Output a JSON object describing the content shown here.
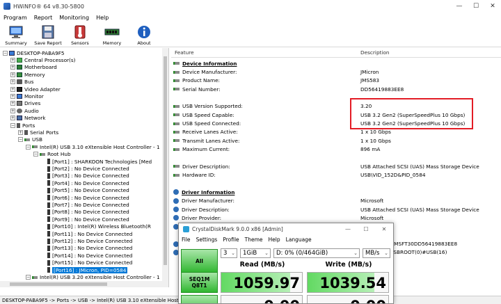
{
  "window": {
    "title": "HWiNFO® 64 v8.30-5800"
  },
  "menu": [
    "Program",
    "Report",
    "Monitoring",
    "Help"
  ],
  "toolbar": [
    {
      "label": "Summary",
      "icon": "summary-icon"
    },
    {
      "label": "Save Report",
      "icon": "save-icon"
    },
    {
      "label": "Sensors",
      "icon": "sensors-icon"
    },
    {
      "label": "Memory",
      "icon": "memory-icon"
    },
    {
      "label": "About",
      "icon": "about-icon"
    }
  ],
  "tree": [
    {
      "label": "DESKTOP-PABA9F5",
      "level": 0,
      "exp": "-",
      "icon": "computer-icon"
    },
    {
      "label": "Central Processor(s)",
      "level": 1,
      "exp": "+",
      "icon": "cpu-icon"
    },
    {
      "label": "Motherboard",
      "level": 1,
      "exp": "+",
      "icon": "motherboard-icon"
    },
    {
      "label": "Memory",
      "level": 1,
      "exp": "+",
      "icon": "memory-icon"
    },
    {
      "label": "Bus",
      "level": 1,
      "exp": "+",
      "icon": "bus-icon"
    },
    {
      "label": "Video Adapter",
      "level": 1,
      "exp": "+",
      "icon": "video-icon"
    },
    {
      "label": "Monitor",
      "level": 1,
      "exp": "+",
      "icon": "monitor-icon"
    },
    {
      "label": "Drives",
      "level": 1,
      "exp": "+",
      "icon": "drive-icon"
    },
    {
      "label": "Audio",
      "level": 1,
      "exp": "+",
      "icon": "audio-icon"
    },
    {
      "label": "Network",
      "level": 1,
      "exp": "+",
      "icon": "network-icon"
    },
    {
      "label": "Ports",
      "level": 1,
      "exp": "-",
      "icon": "port-icon"
    },
    {
      "label": "Serial Ports",
      "level": 2,
      "exp": "+",
      "icon": "port-icon"
    },
    {
      "label": "USB",
      "level": 2,
      "exp": "-",
      "icon": "usb-icon"
    },
    {
      "label": "Intel(R) USB 3.10 eXtensible Host Controller - 1",
      "level": 3,
      "exp": "-",
      "icon": "usb-icon"
    },
    {
      "label": "Root Hub",
      "level": 4,
      "exp": "-",
      "icon": "usb-icon"
    },
    {
      "label": "[Port1] : SHARKOON Technologies [Med",
      "level": 5,
      "exp": "",
      "icon": "plug-icon"
    },
    {
      "label": "[Port2] : No Device Connected",
      "level": 5,
      "exp": "",
      "icon": "plug-icon"
    },
    {
      "label": "[Port3] : No Device Connected",
      "level": 5,
      "exp": "",
      "icon": "plug-icon"
    },
    {
      "label": "[Port4] : No Device Connected",
      "level": 5,
      "exp": "",
      "icon": "plug-icon"
    },
    {
      "label": "[Port5] : No Device Connected",
      "level": 5,
      "exp": "",
      "icon": "plug-icon"
    },
    {
      "label": "[Port6] : No Device Connected",
      "level": 5,
      "exp": "",
      "icon": "plug-icon"
    },
    {
      "label": "[Port7] : No Device Connected",
      "level": 5,
      "exp": "",
      "icon": "plug-icon"
    },
    {
      "label": "[Port8] : No Device Connected",
      "level": 5,
      "exp": "",
      "icon": "plug-icon"
    },
    {
      "label": "[Port9] : No Device Connected",
      "level": 5,
      "exp": "",
      "icon": "plug-icon"
    },
    {
      "label": "[Port10] : Intel(R) Wireless Bluetooth(R",
      "level": 5,
      "exp": "",
      "icon": "plug-icon"
    },
    {
      "label": "[Port11] : No Device Connected",
      "level": 5,
      "exp": "",
      "icon": "plug-icon"
    },
    {
      "label": "[Port12] : No Device Connected",
      "level": 5,
      "exp": "",
      "icon": "plug-icon"
    },
    {
      "label": "[Port13] : No Device Connected",
      "level": 5,
      "exp": "",
      "icon": "plug-icon"
    },
    {
      "label": "[Port14] : No Device Connected",
      "level": 5,
      "exp": "",
      "icon": "plug-icon"
    },
    {
      "label": "[Port15] : No Device Connected",
      "level": 5,
      "exp": "",
      "icon": "plug-icon"
    },
    {
      "label": "[Port16] : JMicron, PID=0584",
      "level": 5,
      "exp": "",
      "icon": "plug-icon",
      "selected": true
    },
    {
      "label": "Intel(R) USB 3.20 eXtensible Host Controller - 1",
      "level": 3,
      "exp": "-",
      "icon": "usb-icon"
    },
    {
      "label": "Root Hub",
      "level": 4,
      "exp": "-",
      "icon": "usb-icon"
    }
  ],
  "details": {
    "col_feature": "Feature",
    "col_description": "Description",
    "rows": [
      {
        "feature": "Device Information",
        "value": "",
        "kind": "section",
        "icon": "usb-icon"
      },
      {
        "feature": "Device Manufacturer:",
        "value": "JMicron",
        "icon": "usb-icon"
      },
      {
        "feature": "Product Name:",
        "value": "JMS583",
        "icon": "usb-icon"
      },
      {
        "feature": "Serial Number:",
        "value": "DD56419883EE8",
        "icon": "usb-icon"
      },
      {
        "feature": "",
        "value": "",
        "kind": "blank"
      },
      {
        "feature": "USB Version Supported:",
        "value": "3.20",
        "icon": "usb-icon"
      },
      {
        "feature": "USB Speed Capable:",
        "value": "USB 3.2 Gen2 (SuperSpeedPlus 10 Gbps)",
        "icon": "usb-icon"
      },
      {
        "feature": "USB Speed Connected:",
        "value": "USB 3.2 Gen2 (SuperSpeedPlus 10 Gbps)",
        "icon": "usb-icon"
      },
      {
        "feature": "Receive Lanes Active:",
        "value": "1 x 10 Gbps",
        "icon": "usb-icon"
      },
      {
        "feature": "Transmit Lanes Active:",
        "value": "1 x 10 Gbps",
        "icon": "usb-icon"
      },
      {
        "feature": "Maximum Current:",
        "value": "896 mA",
        "icon": "usb-icon"
      },
      {
        "feature": "",
        "value": "",
        "kind": "blank"
      },
      {
        "feature": "Driver Description:",
        "value": "USB Attached SCSI (UAS) Mass Storage Device",
        "icon": "usb-icon"
      },
      {
        "feature": "Hardware ID:",
        "value": "USB\\VID_152D&PID_0584",
        "icon": "usb-icon"
      },
      {
        "feature": "",
        "value": "",
        "kind": "blank"
      },
      {
        "feature": "Driver Information",
        "value": "",
        "kind": "section",
        "icon": "gear-icon"
      },
      {
        "feature": "Driver Manufacturer:",
        "value": "Microsoft",
        "icon": "gear-icon"
      },
      {
        "feature": "Driver Description:",
        "value": "USB Attached SCSI (UAS) Mass Storage Device",
        "icon": "gear-icon"
      },
      {
        "feature": "Driver Provider:",
        "value": "Microsoft",
        "icon": "gear-icon"
      },
      {
        "feature": "",
        "value": "882",
        "icon": "gear-icon"
      },
      {
        "feature": "",
        "value": "",
        "kind": "blank"
      },
      {
        "feature": "",
        "value": "D&PID_0584\\MSFT30DD56419883EE8",
        "icon": "gear-icon"
      },
      {
        "feature": "",
        "value": "PCI(1400)#USBROOT(0)#USB(16)",
        "icon": "gear-icon"
      }
    ]
  },
  "status_bar": "DESKTOP-PABA9F5 -> Ports -> USB -> Intel(R) USB 3.10 eXtensible Host Co",
  "crystaldiskmark": {
    "title": "CrystalDiskMark 9.0.0 x86 [Admin]",
    "menu": [
      "File",
      "Settings",
      "Profile",
      "Theme",
      "Help",
      "Language"
    ],
    "count": "3",
    "size": "1GiB",
    "drive": "D: 0% (0/464GiB)",
    "unit": "MB/s",
    "all_label": "All",
    "read_header": "Read (MB/s)",
    "write_header": "Write (MB/s)",
    "tests": [
      {
        "line1": "SEQ1M",
        "line2": "Q8T1",
        "read": "1059.97",
        "write": "1039.54",
        "read_level": 0.85,
        "write_level": 0.83
      },
      {
        "line1": "SEQ1M",
        "line2": "",
        "read": "0.00",
        "write": "0.00",
        "read_level": 0,
        "write_level": 0
      }
    ]
  }
}
